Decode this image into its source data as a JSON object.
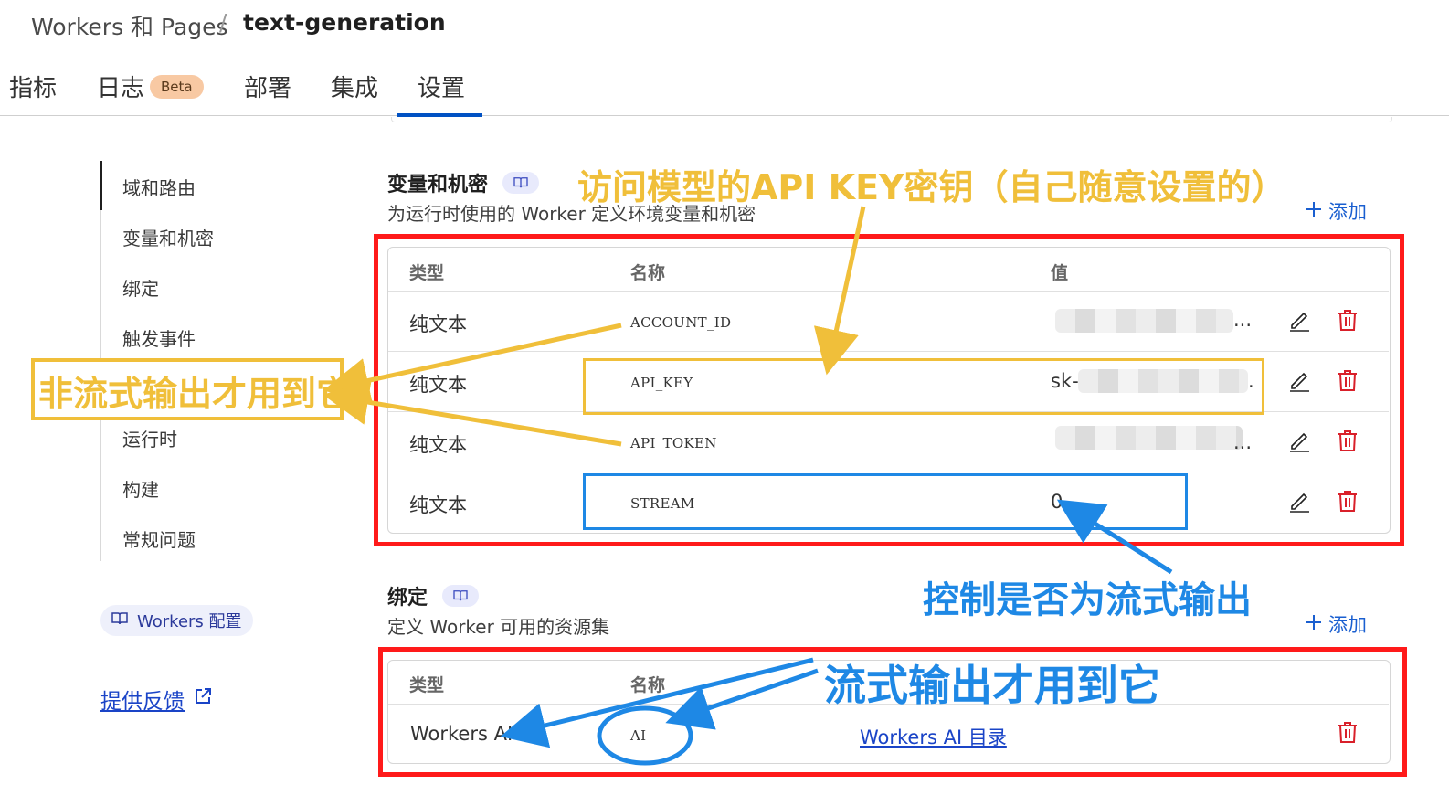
{
  "breadcrumb": {
    "parent": "Workers 和 Pages",
    "separator": "/",
    "current": "text-generation"
  },
  "tabs": [
    {
      "label": "指标"
    },
    {
      "label": "日志",
      "badge": "Beta"
    },
    {
      "label": "部署"
    },
    {
      "label": "集成"
    },
    {
      "label": "设置",
      "active": true
    }
  ],
  "sidebar": {
    "items": [
      {
        "label": "域和路由",
        "active": true
      },
      {
        "label": "变量和机密"
      },
      {
        "label": "绑定"
      },
      {
        "label": "触发事件"
      },
      {
        "label": "运行时"
      },
      {
        "label": "构建"
      },
      {
        "label": "常规问题"
      }
    ],
    "workers_config": "Workers 配置",
    "feedback": "提供反馈"
  },
  "variables": {
    "title": "变量和机密",
    "description": "为运行时使用的 Worker 定义环境变量和机密",
    "add_label": "添加",
    "columns": [
      "类型",
      "名称",
      "值"
    ],
    "rows": [
      {
        "type": "纯文本",
        "name": "ACCOUNT_ID",
        "value": "...",
        "blurred": true
      },
      {
        "type": "纯文本",
        "name": "API_KEY",
        "value": "sk-",
        "value_suffix": ".",
        "blurred": true
      },
      {
        "type": "纯文本",
        "name": "API_TOKEN",
        "value": "...",
        "blurred": true
      },
      {
        "type": "纯文本",
        "name": "STREAM",
        "value": "0",
        "blurred": false
      }
    ]
  },
  "bindings": {
    "title": "绑定",
    "description": "定义 Worker 可用的资源集",
    "add_label": "添加",
    "columns": [
      "类型",
      "名称"
    ],
    "rows": [
      {
        "type": "Workers AI",
        "name": "AI",
        "link": "Workers AI 目录"
      }
    ]
  },
  "annotations": {
    "api_key_note": "访问模型的API KEY密钥（自己随意设置的）",
    "non_stream_note": "非流式输出才用到它",
    "stream_control_note": "控制是否为流式输出",
    "stream_use_note": "流式输出才用到它",
    "yellow_color": "#f0bf3a",
    "blue_color": "#1e88e5",
    "red_color": "#ff1a1a"
  },
  "icons": [
    "book-icon",
    "plus-icon",
    "pencil-icon",
    "trash-icon",
    "external-link-icon"
  ]
}
